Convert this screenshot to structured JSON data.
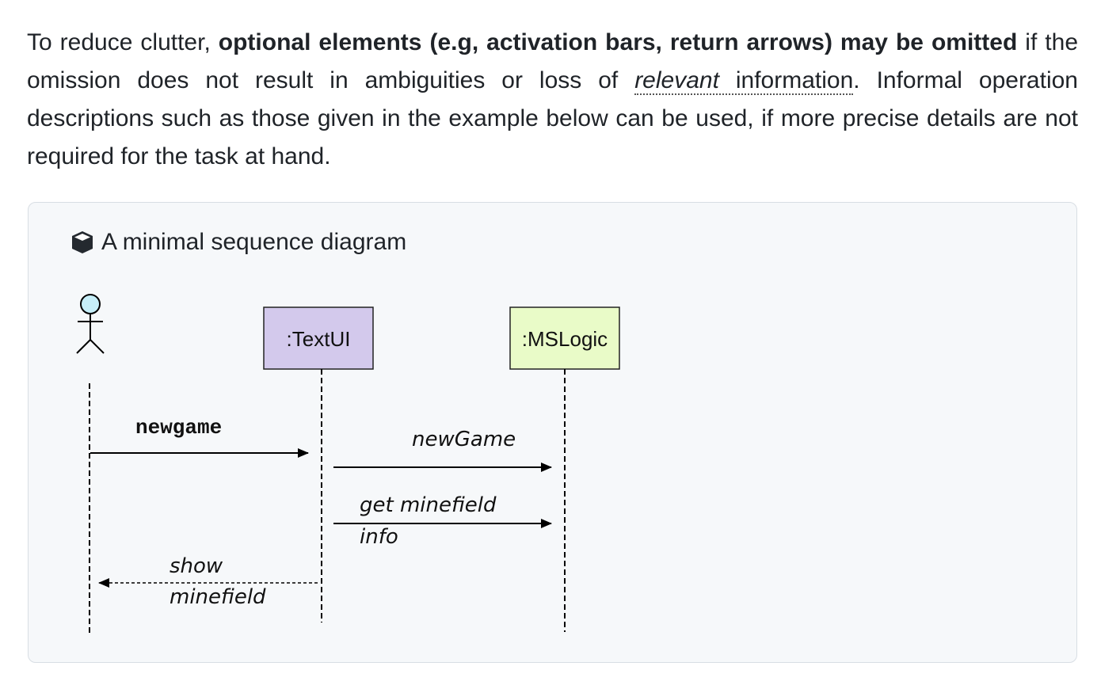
{
  "paragraph": {
    "part1": "To reduce clutter, ",
    "bold": "optional elements (e.g, activation bars, return arrows) may be omitted",
    "part2": " if the omission does not result in ambiguities or loss of ",
    "relevant": "relevant",
    "information": " information",
    "part3": ". Informal operation descriptions such as those given in the example below can be used, if more precise details are not required for the task at hand."
  },
  "example_box": {
    "icon": "cube-icon",
    "title": "A minimal sequence diagram"
  },
  "diagram": {
    "participants": [
      ":TextUI",
      ":MSLogic"
    ],
    "messages": {
      "newgame": "newgame",
      "newGame": "newGame",
      "get_minefield_line1": "get minefield",
      "get_minefield_line2": "info",
      "show_line1": "show",
      "show_line2": "minefield"
    },
    "colors": {
      "textui_fill": "#d3c9ec",
      "mslogic_fill": "#e9fbc8",
      "actor_head": "#c6eef8"
    }
  }
}
